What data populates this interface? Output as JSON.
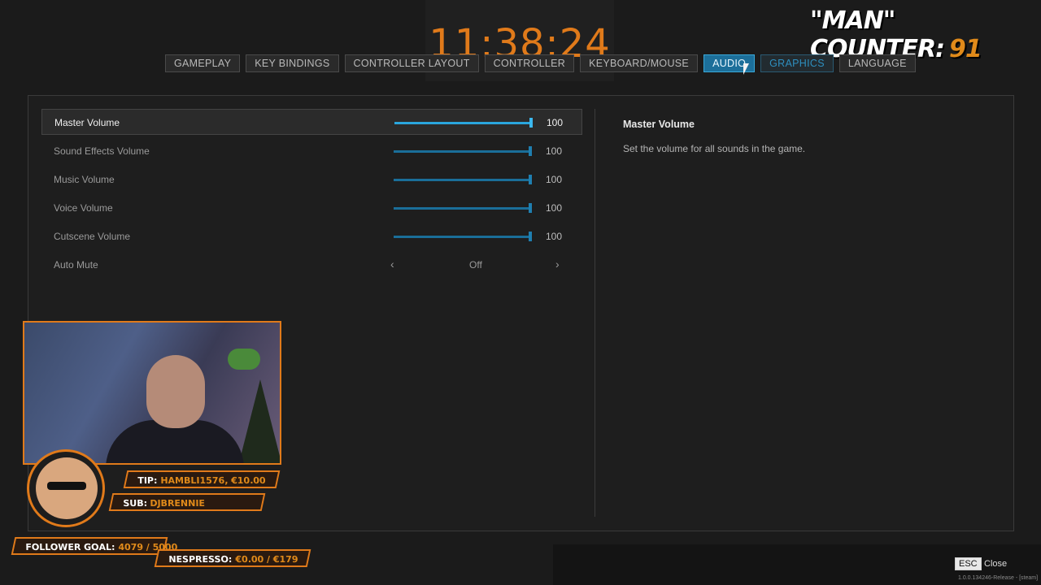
{
  "overlay": {
    "clock": "11:38:24",
    "man_counter_label": "\"MAN\" COUNTER:",
    "man_counter_value": "91"
  },
  "tabs": [
    {
      "label": "GAMEPLAY"
    },
    {
      "label": "KEY BINDINGS"
    },
    {
      "label": "CONTROLLER LAYOUT"
    },
    {
      "label": "CONTROLLER"
    },
    {
      "label": "KEYBOARD/MOUSE"
    },
    {
      "label": "AUDIO"
    },
    {
      "label": "GRAPHICS"
    },
    {
      "label": "LANGUAGE"
    }
  ],
  "active_tab": "AUDIO",
  "settings": [
    {
      "label": "Master Volume",
      "value": "100",
      "level": 1.0
    },
    {
      "label": "Sound Effects Volume",
      "value": "100",
      "level": 1.0
    },
    {
      "label": "Music Volume",
      "value": "100",
      "level": 1.0
    },
    {
      "label": "Voice Volume",
      "value": "100",
      "level": 1.0
    },
    {
      "label": "Cutscene Volume",
      "value": "100",
      "level": 1.0
    },
    {
      "label": "Auto Mute",
      "value": "Off",
      "left_arrow": "‹",
      "right_arrow": "›"
    }
  ],
  "description": {
    "title": "Master Volume",
    "text": "Set the volume for all sounds in the game."
  },
  "stream": {
    "tip_label": "TIP:",
    "tip_value": "HAMBLI1576, €10.00",
    "sub_label": "SUB:",
    "sub_value": "DJBRENNIE",
    "follower_label": "FOLLOWER GOAL:",
    "follower_value": "4079 / 5000",
    "nespresso_label": "NESPRESSO:",
    "nespresso_value": "€0.00 / €179"
  },
  "footer": {
    "esc_key": "ESC",
    "close_label": "Close",
    "version": "1.0.0.134246-Release - [steam]"
  },
  "colors": {
    "accent_blue": "#2aa6dc",
    "stream_orange": "#e07a1a"
  }
}
